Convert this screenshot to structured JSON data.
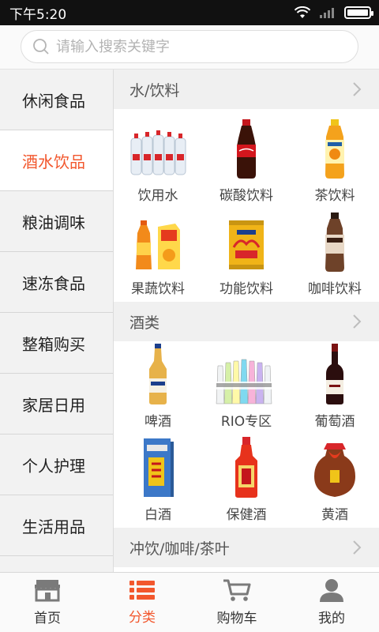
{
  "status_bar": {
    "time": "下午5:20"
  },
  "search": {
    "placeholder": "请输入搜索关键字"
  },
  "sidebar": {
    "items": [
      {
        "label": "休闲食品"
      },
      {
        "label": "酒水饮品"
      },
      {
        "label": "粮油调味"
      },
      {
        "label": "速冻食品"
      },
      {
        "label": "整箱购买"
      },
      {
        "label": "家居日用"
      },
      {
        "label": "个人护理"
      },
      {
        "label": "生活用品"
      }
    ],
    "active_index": 1
  },
  "sections": [
    {
      "title": "水/饮料",
      "items": [
        {
          "label": "饮用水",
          "icon": "water-bottles-icon"
        },
        {
          "label": "碳酸饮料",
          "icon": "cola-bottle-icon"
        },
        {
          "label": "茶饮料",
          "icon": "tea-bottle-icon"
        },
        {
          "label": "果蔬饮料",
          "icon": "juice-icon"
        },
        {
          "label": "功能饮料",
          "icon": "energy-can-icon"
        },
        {
          "label": "咖啡饮料",
          "icon": "coffee-bottle-icon"
        }
      ]
    },
    {
      "title": "酒类",
      "items": [
        {
          "label": "啤酒",
          "icon": "beer-bottle-icon"
        },
        {
          "label": "RIO专区",
          "icon": "rio-bottles-icon"
        },
        {
          "label": "葡萄酒",
          "icon": "wine-bottle-icon"
        },
        {
          "label": "白酒",
          "icon": "baijiu-box-icon"
        },
        {
          "label": "保健酒",
          "icon": "health-wine-icon"
        },
        {
          "label": "黄酒",
          "icon": "yellow-wine-jar-icon"
        }
      ]
    },
    {
      "title": "冲饮/咖啡/茶叶"
    }
  ],
  "bottom_nav": {
    "items": [
      {
        "label": "首页",
        "icon": "store-icon"
      },
      {
        "label": "分类",
        "icon": "list-icon"
      },
      {
        "label": "购物车",
        "icon": "cart-icon"
      },
      {
        "label": "我的",
        "icon": "user-icon"
      }
    ],
    "active_index": 1
  },
  "colors": {
    "accent": "#f2572d",
    "text": "#222222",
    "muted": "#9a9a9a"
  }
}
